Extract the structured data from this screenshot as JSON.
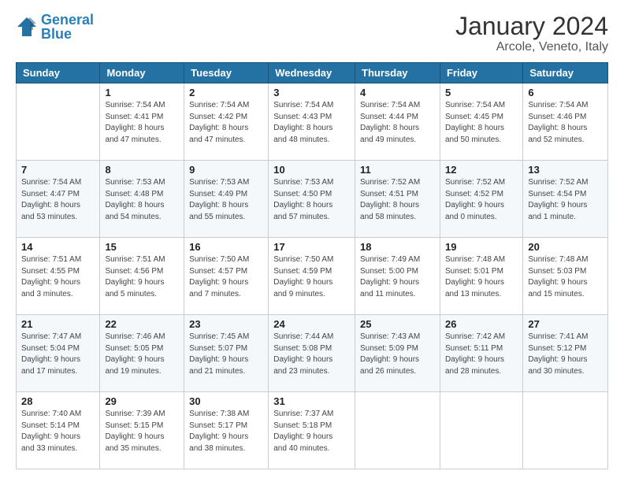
{
  "logo": {
    "text1": "General",
    "text2": "Blue"
  },
  "header": {
    "title": "January 2024",
    "subtitle": "Arcole, Veneto, Italy"
  },
  "days_of_week": [
    "Sunday",
    "Monday",
    "Tuesday",
    "Wednesday",
    "Thursday",
    "Friday",
    "Saturday"
  ],
  "weeks": [
    [
      {
        "day": "",
        "info": ""
      },
      {
        "day": "1",
        "info": "Sunrise: 7:54 AM\nSunset: 4:41 PM\nDaylight: 8 hours\nand 47 minutes."
      },
      {
        "day": "2",
        "info": "Sunrise: 7:54 AM\nSunset: 4:42 PM\nDaylight: 8 hours\nand 47 minutes."
      },
      {
        "day": "3",
        "info": "Sunrise: 7:54 AM\nSunset: 4:43 PM\nDaylight: 8 hours\nand 48 minutes."
      },
      {
        "day": "4",
        "info": "Sunrise: 7:54 AM\nSunset: 4:44 PM\nDaylight: 8 hours\nand 49 minutes."
      },
      {
        "day": "5",
        "info": "Sunrise: 7:54 AM\nSunset: 4:45 PM\nDaylight: 8 hours\nand 50 minutes."
      },
      {
        "day": "6",
        "info": "Sunrise: 7:54 AM\nSunset: 4:46 PM\nDaylight: 8 hours\nand 52 minutes."
      }
    ],
    [
      {
        "day": "7",
        "info": "Sunrise: 7:54 AM\nSunset: 4:47 PM\nDaylight: 8 hours\nand 53 minutes."
      },
      {
        "day": "8",
        "info": "Sunrise: 7:53 AM\nSunset: 4:48 PM\nDaylight: 8 hours\nand 54 minutes."
      },
      {
        "day": "9",
        "info": "Sunrise: 7:53 AM\nSunset: 4:49 PM\nDaylight: 8 hours\nand 55 minutes."
      },
      {
        "day": "10",
        "info": "Sunrise: 7:53 AM\nSunset: 4:50 PM\nDaylight: 8 hours\nand 57 minutes."
      },
      {
        "day": "11",
        "info": "Sunrise: 7:52 AM\nSunset: 4:51 PM\nDaylight: 8 hours\nand 58 minutes."
      },
      {
        "day": "12",
        "info": "Sunrise: 7:52 AM\nSunset: 4:52 PM\nDaylight: 9 hours\nand 0 minutes."
      },
      {
        "day": "13",
        "info": "Sunrise: 7:52 AM\nSunset: 4:54 PM\nDaylight: 9 hours\nand 1 minute."
      }
    ],
    [
      {
        "day": "14",
        "info": "Sunrise: 7:51 AM\nSunset: 4:55 PM\nDaylight: 9 hours\nand 3 minutes."
      },
      {
        "day": "15",
        "info": "Sunrise: 7:51 AM\nSunset: 4:56 PM\nDaylight: 9 hours\nand 5 minutes."
      },
      {
        "day": "16",
        "info": "Sunrise: 7:50 AM\nSunset: 4:57 PM\nDaylight: 9 hours\nand 7 minutes."
      },
      {
        "day": "17",
        "info": "Sunrise: 7:50 AM\nSunset: 4:59 PM\nDaylight: 9 hours\nand 9 minutes."
      },
      {
        "day": "18",
        "info": "Sunrise: 7:49 AM\nSunset: 5:00 PM\nDaylight: 9 hours\nand 11 minutes."
      },
      {
        "day": "19",
        "info": "Sunrise: 7:48 AM\nSunset: 5:01 PM\nDaylight: 9 hours\nand 13 minutes."
      },
      {
        "day": "20",
        "info": "Sunrise: 7:48 AM\nSunset: 5:03 PM\nDaylight: 9 hours\nand 15 minutes."
      }
    ],
    [
      {
        "day": "21",
        "info": "Sunrise: 7:47 AM\nSunset: 5:04 PM\nDaylight: 9 hours\nand 17 minutes."
      },
      {
        "day": "22",
        "info": "Sunrise: 7:46 AM\nSunset: 5:05 PM\nDaylight: 9 hours\nand 19 minutes."
      },
      {
        "day": "23",
        "info": "Sunrise: 7:45 AM\nSunset: 5:07 PM\nDaylight: 9 hours\nand 21 minutes."
      },
      {
        "day": "24",
        "info": "Sunrise: 7:44 AM\nSunset: 5:08 PM\nDaylight: 9 hours\nand 23 minutes."
      },
      {
        "day": "25",
        "info": "Sunrise: 7:43 AM\nSunset: 5:09 PM\nDaylight: 9 hours\nand 26 minutes."
      },
      {
        "day": "26",
        "info": "Sunrise: 7:42 AM\nSunset: 5:11 PM\nDaylight: 9 hours\nand 28 minutes."
      },
      {
        "day": "27",
        "info": "Sunrise: 7:41 AM\nSunset: 5:12 PM\nDaylight: 9 hours\nand 30 minutes."
      }
    ],
    [
      {
        "day": "28",
        "info": "Sunrise: 7:40 AM\nSunset: 5:14 PM\nDaylight: 9 hours\nand 33 minutes."
      },
      {
        "day": "29",
        "info": "Sunrise: 7:39 AM\nSunset: 5:15 PM\nDaylight: 9 hours\nand 35 minutes."
      },
      {
        "day": "30",
        "info": "Sunrise: 7:38 AM\nSunset: 5:17 PM\nDaylight: 9 hours\nand 38 minutes."
      },
      {
        "day": "31",
        "info": "Sunrise: 7:37 AM\nSunset: 5:18 PM\nDaylight: 9 hours\nand 40 minutes."
      },
      {
        "day": "",
        "info": ""
      },
      {
        "day": "",
        "info": ""
      },
      {
        "day": "",
        "info": ""
      }
    ]
  ]
}
